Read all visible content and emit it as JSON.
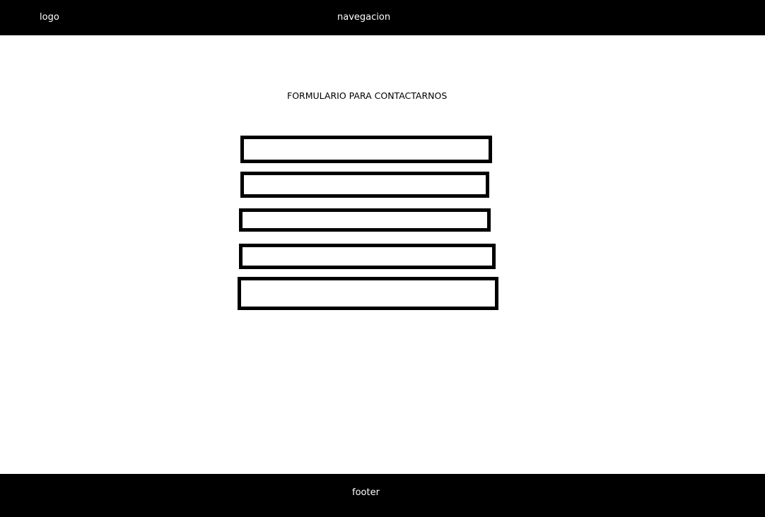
{
  "header": {
    "logo": "logo",
    "navigation": "navegacion"
  },
  "form": {
    "title": "FORMULARIO PARA CONTACTARNOS",
    "fields": [
      {
        "value": ""
      },
      {
        "value": ""
      },
      {
        "value": ""
      },
      {
        "value": ""
      },
      {
        "value": ""
      }
    ]
  },
  "footer": {
    "text": "footer"
  },
  "colors": {
    "background": "#ffffff",
    "bars": "#000000",
    "bar_text": "#ffffff",
    "border": "#000000"
  }
}
